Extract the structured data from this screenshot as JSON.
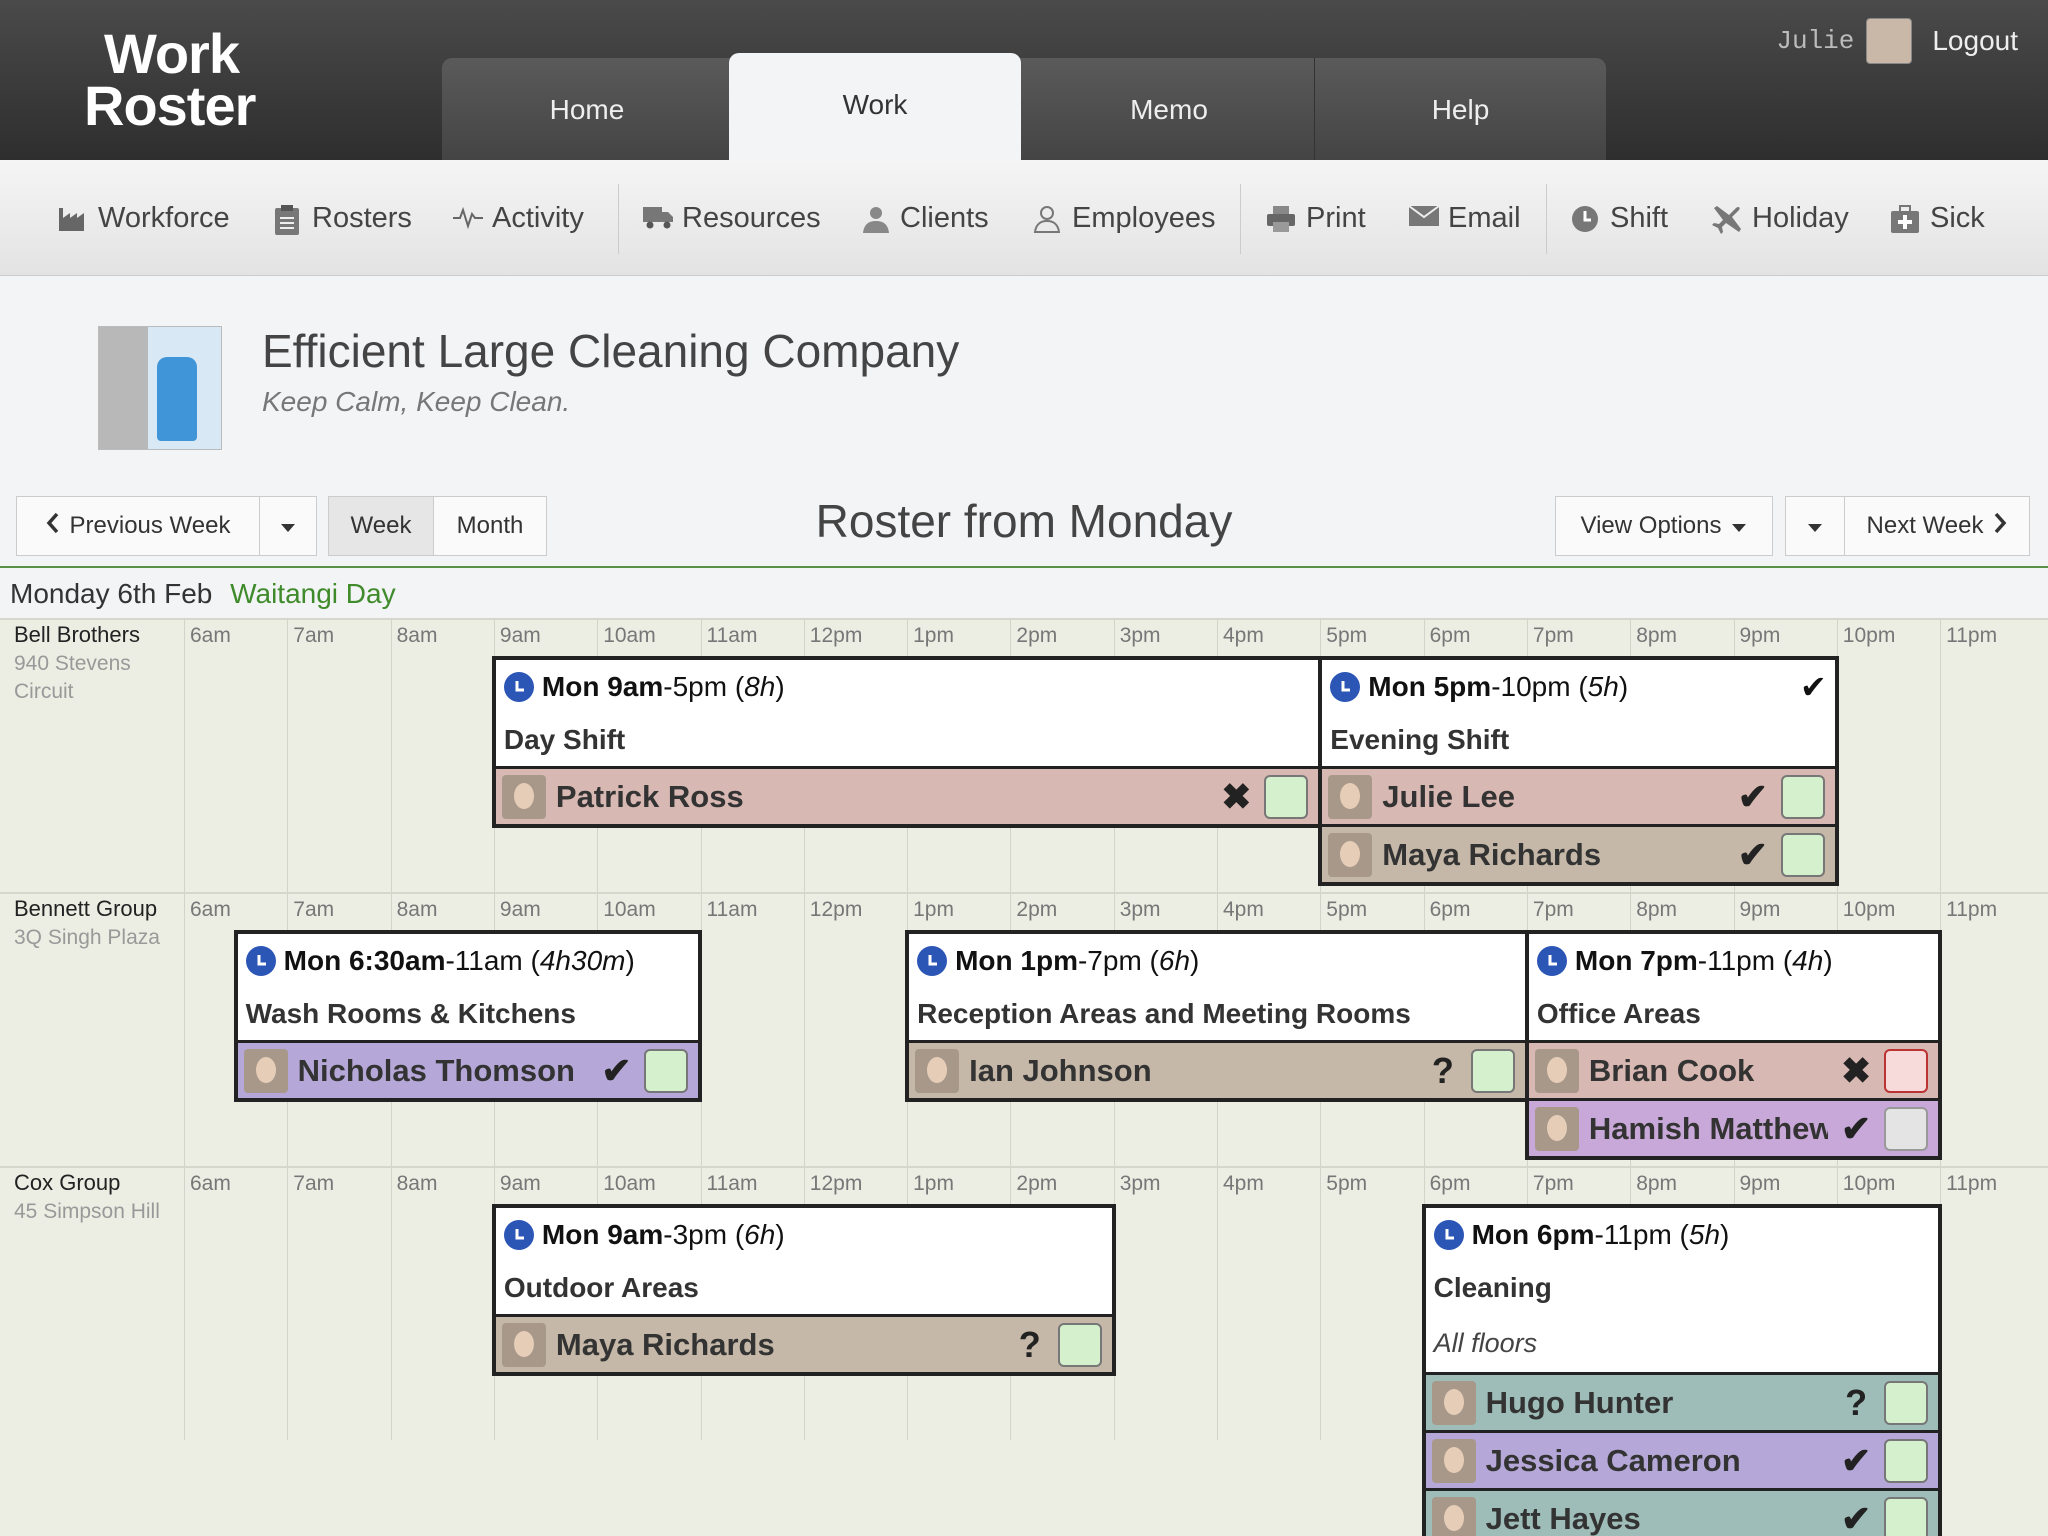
{
  "app": {
    "logo_line1": "Work",
    "logo_line2": "Roster"
  },
  "tabs": [
    {
      "label": "Home"
    },
    {
      "label": "Work"
    },
    {
      "label": "Memo"
    },
    {
      "label": "Help"
    }
  ],
  "user": {
    "name": "Julie",
    "logout": "Logout"
  },
  "toolbar": [
    {
      "label": "Workforce",
      "icon": "factory-icon"
    },
    {
      "label": "Rosters",
      "icon": "clipboard-icon"
    },
    {
      "label": "Activity",
      "icon": "pulse-icon"
    },
    {
      "label": "Resources",
      "icon": "truck-icon"
    },
    {
      "label": "Clients",
      "icon": "client-icon"
    },
    {
      "label": "Employees",
      "icon": "user-icon"
    },
    {
      "label": "Print",
      "icon": "printer-icon"
    },
    {
      "label": "Email",
      "icon": "envelope-icon"
    },
    {
      "label": "Shift",
      "icon": "clock-icon"
    },
    {
      "label": "Holiday",
      "icon": "plane-icon"
    },
    {
      "label": "Sick",
      "icon": "medkit-icon"
    }
  ],
  "company": {
    "name": "Efficient Large Cleaning Company",
    "tagline": "Keep Calm, Keep Clean."
  },
  "nav": {
    "prev": "Previous Week",
    "week": "Week",
    "month": "Month",
    "title": "Roster from Monday",
    "view_options": "View Options",
    "next": "Next Week"
  },
  "day": {
    "date": "Monday 6th Feb",
    "holiday": "Waitangi Day"
  },
  "hours": [
    "6am",
    "7am",
    "8am",
    "9am",
    "10am",
    "11am",
    "12pm",
    "1pm",
    "2pm",
    "3pm",
    "4pm",
    "5pm",
    "6pm",
    "7pm",
    "8pm",
    "9pm",
    "10pm",
    "11pm"
  ],
  "sites": [
    {
      "name": "Bell Brothers",
      "address": "940 Stevens Circuit"
    },
    {
      "name": "Bennett Group",
      "address": "3Q Singh Plaza"
    },
    {
      "name": "Cox Group",
      "address": "45 Simpson Hill"
    }
  ],
  "shifts": [
    {
      "day": "Mon",
      "start": "9am",
      "end": "5pm",
      "duration": "8h",
      "title": "Day Shift",
      "confirmed": false,
      "staff": [
        {
          "name": "Patrick Ross",
          "status": "✖",
          "color": "#d8b8b2",
          "box": "green"
        }
      ]
    },
    {
      "day": "Mon",
      "start": "5pm",
      "end": "10pm",
      "duration": "5h",
      "title": "Evening Shift",
      "confirmed": true,
      "staff": [
        {
          "name": "Julie Lee",
          "status": "✔",
          "color": "#d8b8b2",
          "box": "green"
        },
        {
          "name": "Maya Richards",
          "status": "✔",
          "color": "#c6b8a8",
          "box": "green"
        }
      ]
    },
    {
      "day": "Mon",
      "start": "6:30am",
      "end": "11am",
      "duration": "4h30m",
      "title": "Wash Rooms & Kitchens",
      "confirmed": false,
      "staff": [
        {
          "name": "Nicholas Thomson",
          "status": "✔",
          "color": "#b5a8d8",
          "box": "green"
        }
      ]
    },
    {
      "day": "Mon",
      "start": "1pm",
      "end": "7pm",
      "duration": "6h",
      "title": "Reception Areas and Meeting Rooms",
      "confirmed": false,
      "staff": [
        {
          "name": "Ian Johnson",
          "status": "?",
          "color": "#c6b8a8",
          "box": "green"
        }
      ]
    },
    {
      "day": "Mon",
      "start": "7pm",
      "end": "11pm",
      "duration": "4h",
      "title": "Office Areas",
      "confirmed": false,
      "staff": [
        {
          "name": "Brian Cook",
          "status": "✖",
          "color": "#d8b8b2",
          "box": "red"
        },
        {
          "name": "Hamish Matthews",
          "status": "✔",
          "color": "#c8a8d8",
          "box": "grey"
        }
      ]
    },
    {
      "day": "Mon",
      "start": "9am",
      "end": "3pm",
      "duration": "6h",
      "title": "Outdoor Areas",
      "confirmed": false,
      "staff": [
        {
          "name": "Maya Richards",
          "status": "?",
          "color": "#c6b8a8",
          "box": "green"
        }
      ]
    },
    {
      "day": "Mon",
      "start": "6pm",
      "end": "11pm",
      "duration": "5h",
      "title": "Cleaning",
      "note": "All floors",
      "confirmed": false,
      "staff": [
        {
          "name": "Hugo Hunter",
          "status": "?",
          "color": "#9fbdb8",
          "box": "green"
        },
        {
          "name": "Jessica Cameron",
          "status": "✔",
          "color": "#b5a8d8",
          "box": "green"
        },
        {
          "name": "Jett Hayes",
          "status": "✔",
          "color": "#9fbdb8",
          "box": "green"
        }
      ]
    }
  ]
}
